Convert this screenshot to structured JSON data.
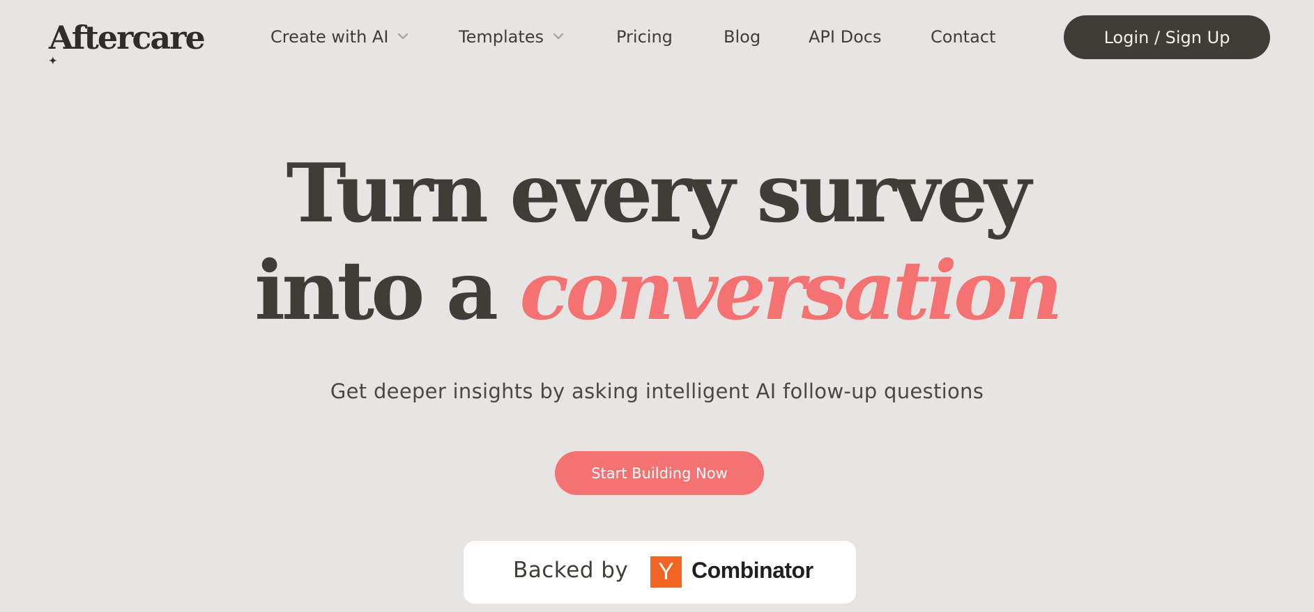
{
  "header": {
    "logo": "Aftercare",
    "nav": [
      {
        "label": "Create with AI",
        "has_dropdown": true
      },
      {
        "label": "Templates",
        "has_dropdown": true
      },
      {
        "label": "Pricing",
        "has_dropdown": false
      },
      {
        "label": "Blog",
        "has_dropdown": false
      },
      {
        "label": "API Docs",
        "has_dropdown": false
      },
      {
        "label": "Contact",
        "has_dropdown": false
      }
    ],
    "login_label": "Login / Sign Up"
  },
  "hero": {
    "headline_line1": "Turn every survey",
    "headline_line2_prefix": "into a",
    "headline_accent": "conversation",
    "subtitle": "Get deeper insights by asking intelligent AI follow-up questions",
    "cta_label": "Start Building Now"
  },
  "backed": {
    "label": "Backed by",
    "logo_letter": "Y",
    "company": "Combinator"
  },
  "colors": {
    "background": "#e6e5e3",
    "text_dark": "#403d39",
    "accent_coral": "#f47272",
    "button_dark": "#403d38",
    "yc_orange": "#f26522"
  },
  "icons": {
    "logo_sparkle": "sparkle-icon",
    "dropdown": "chevron-down-icon"
  }
}
